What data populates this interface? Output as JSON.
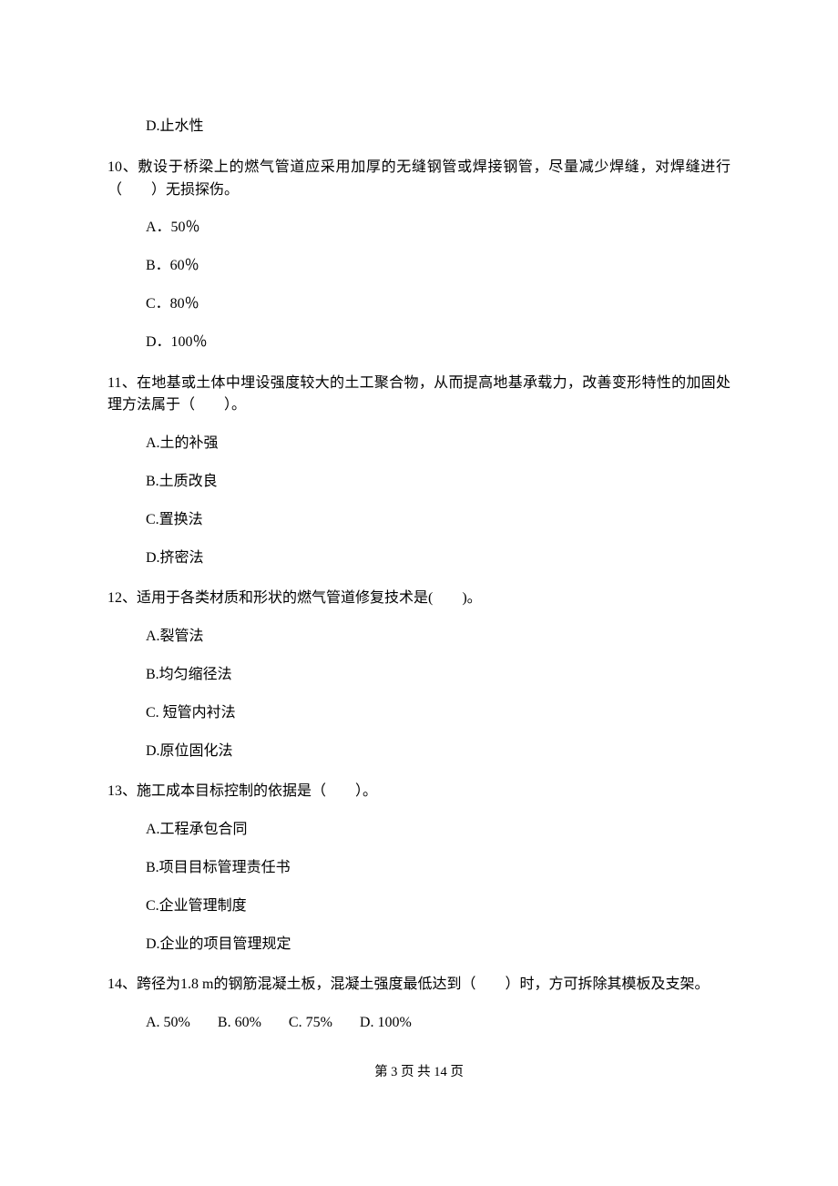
{
  "q9": {
    "d": "D.止水性"
  },
  "q10": {
    "stem": "10、敷设于桥梁上的燃气管道应采用加厚的无缝钢管或焊接钢管，尽量减少焊缝，对焊缝进行（　　）无损探伤。",
    "a": "A．50％",
    "b": "B．60％",
    "c": "C．80％",
    "d": "D．100％"
  },
  "q11": {
    "stem": "11、在地基或土体中埋设强度较大的土工聚合物，从而提高地基承载力，改善变形特性的加固处理方法属于（　　）。",
    "a": "A.土的补强",
    "b": "B.土质改良",
    "c": "C.置换法",
    "d": "D.挤密法"
  },
  "q12": {
    "stem": "12、适用于各类材质和形状的燃气管道修复技术是(　　)。",
    "a": "A.裂管法",
    "b": "B.均匀缩径法",
    "c": "C. 短管内衬法",
    "d": "D.原位固化法"
  },
  "q13": {
    "stem": "13、施工成本目标控制的依据是（　　）。",
    "a": "A.工程承包合同",
    "b": "B.项目目标管理责任书",
    "c": "C.企业管理制度",
    "d": "D.企业的项目管理规定"
  },
  "q14": {
    "stem": "14、跨径为1.8 m的钢筋混凝土板，混凝土强度最低达到（　　）时，方可拆除其模板及支架。",
    "a": "A. 50%",
    "b": "B. 60%",
    "c": "C. 75%",
    "d": "D. 100%"
  },
  "footer": "第 3 页 共 14 页"
}
